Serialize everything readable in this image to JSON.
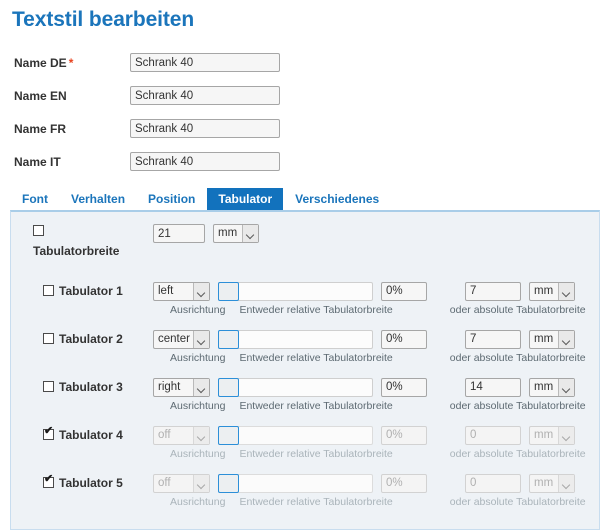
{
  "page": {
    "title": "Textstil bearbeiten"
  },
  "name_fields": [
    {
      "label": "Name DE",
      "required": true,
      "value": "Schrank 40"
    },
    {
      "label": "Name EN",
      "required": false,
      "value": "Schrank 40"
    },
    {
      "label": "Name FR",
      "required": false,
      "value": "Schrank 40"
    },
    {
      "label": "Name IT",
      "required": false,
      "value": "Schrank 40"
    }
  ],
  "required_marker": "*",
  "tabs": [
    {
      "label": "Font",
      "active": false
    },
    {
      "label": "Verhalten",
      "active": false
    },
    {
      "label": "Position",
      "active": false
    },
    {
      "label": "Tabulator",
      "active": true
    },
    {
      "label": "Verschiedenes",
      "active": false
    }
  ],
  "tab_width": {
    "checkbox_checked": false,
    "caption": "Tabulatorbreite",
    "value": "21",
    "unit": "mm"
  },
  "hints": {
    "alignment": "Ausrichtung",
    "relative": "Entweder relative Tabulatorbreite",
    "absolute": "oder absolute Tabulatorbreite"
  },
  "tabulators": [
    {
      "label": "Tabulator 1",
      "checked": false,
      "disabled": false,
      "alignment": "left",
      "slider_percent": 0,
      "percent_value": "0%",
      "absolute_value": "7",
      "unit": "mm"
    },
    {
      "label": "Tabulator 2",
      "checked": false,
      "disabled": false,
      "alignment": "center",
      "slider_percent": 0,
      "percent_value": "0%",
      "absolute_value": "7",
      "unit": "mm"
    },
    {
      "label": "Tabulator 3",
      "checked": false,
      "disabled": false,
      "alignment": "right",
      "slider_percent": 0,
      "percent_value": "0%",
      "absolute_value": "14",
      "unit": "mm"
    },
    {
      "label": "Tabulator 4",
      "checked": true,
      "disabled": true,
      "alignment": "off",
      "slider_percent": 0,
      "percent_value": "0%",
      "absolute_value": "0",
      "unit": "mm"
    },
    {
      "label": "Tabulator 5",
      "checked": true,
      "disabled": true,
      "alignment": "off",
      "slider_percent": 0,
      "percent_value": "0%",
      "absolute_value": "0",
      "unit": "mm"
    }
  ],
  "colors": {
    "title_blue": "#1b75bb",
    "active_tab_blue": "#1272bd",
    "panel_bg": "#eef2f6",
    "required_red": "#e8431f",
    "slider_handle_border": "#2c8fd8"
  }
}
